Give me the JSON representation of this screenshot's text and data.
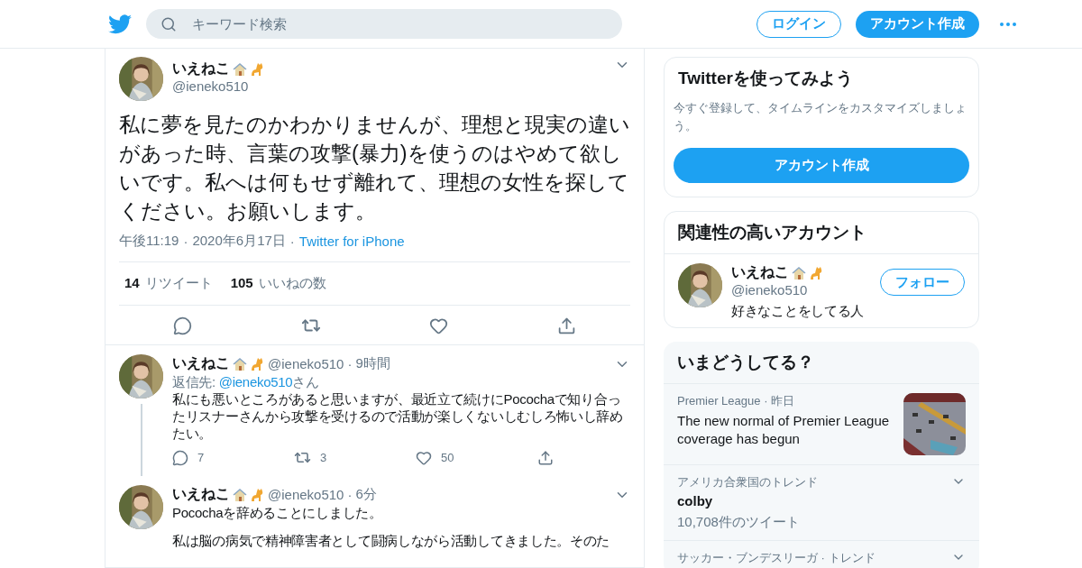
{
  "header": {
    "search_placeholder": "キーワード検索",
    "login": "ログイン",
    "signup": "アカウント作成"
  },
  "tweet": {
    "name": "いえねこ",
    "handle": "@ieneko510",
    "text": "私に夢を見たのかわかりませんが、理想と現実の違いがあった時、言葉の攻撃(暴力)を使うのはやめて欲しいです。私へは何もせず離れて、理想の女性を探してください。お願いします。",
    "separator": "·",
    "time": "午後11:19",
    "date": "2020年6月17日",
    "source": "Twitter for iPhone",
    "stats": [
      {
        "count": "14",
        "label": "リツイート"
      },
      {
        "count": "105",
        "label": "いいねの数"
      }
    ]
  },
  "replies": [
    {
      "name": "いえねこ",
      "handle": "@ieneko510",
      "separator": "·",
      "age": "9時間",
      "reply_prefix": "返信先: ",
      "reply_to": "@ieneko510",
      "reply_suffix": "さん",
      "paragraphs": [
        "私にも悪いところがあると思いますが、最近立て続けにPocochaで知り合ったリスナーさんから攻撃を受けるので活動が楽しくないしむしろ怖いし辞めたい。"
      ],
      "replies": "7",
      "retweets": "3",
      "likes": "50",
      "thread": true
    },
    {
      "name": "いえねこ",
      "handle": "@ieneko510",
      "separator": "·",
      "age": "6分",
      "paragraphs": [
        "Pocochaを辞めることにしました。",
        "私は脳の病気で精神障害者として闘病しながら活動してきました。そのた"
      ],
      "thread": false
    }
  ],
  "sidebar": {
    "signup_card": {
      "title": "Twitterを使ってみよう",
      "description": "今すぐ登録して、タイムラインをカスタマイズしましょう。",
      "button": "アカウント作成"
    },
    "related": {
      "title": "関連性の高いアカウント",
      "name": "いえねこ",
      "handle": "@ieneko510",
      "bio": "好きなことをしてる人",
      "follow": "フォロー"
    },
    "trends": {
      "title": "いまどうしてる？",
      "items": [
        {
          "kind": "news",
          "meta": "Premier League",
          "separator": "·",
          "age": "昨日",
          "title": "The new normal of Premier League coverage has begun"
        },
        {
          "kind": "trend",
          "meta": "アメリカ合衆国のトレンド",
          "title": "colby",
          "count": "10,708件のツイート"
        },
        {
          "kind": "trend",
          "meta": "サッカー・ブンデスリーガ · トレンド"
        }
      ]
    }
  }
}
